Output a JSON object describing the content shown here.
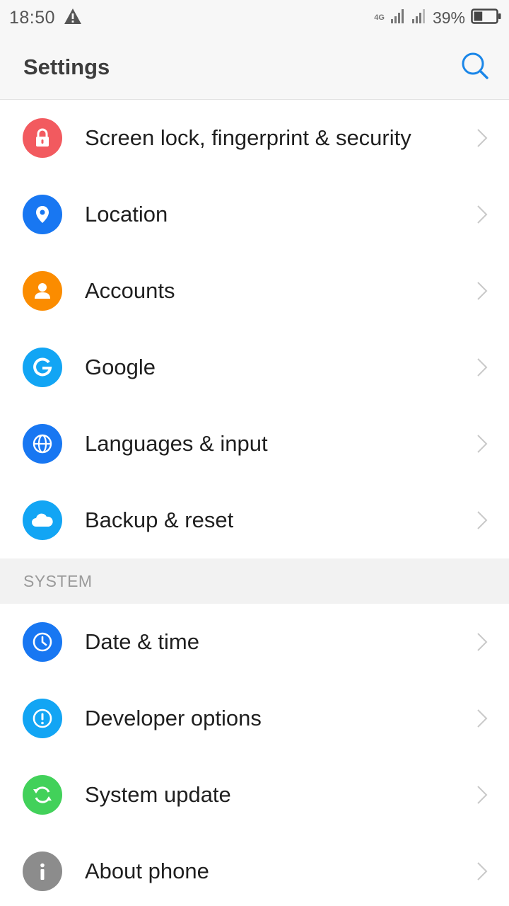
{
  "status_bar": {
    "time": "18:50",
    "network_type": "4G",
    "battery_percent": "39%",
    "battery_level": 0.39
  },
  "header": {
    "title": "Settings",
    "accent_color": "#1a86e8"
  },
  "items": [
    {
      "label": "Screen lock, fingerprint & security",
      "icon": "lock-icon",
      "color": "#f25a5f"
    },
    {
      "label": "Location",
      "icon": "location-pin-icon",
      "color": "#1877f2"
    },
    {
      "label": "Accounts",
      "icon": "person-icon",
      "color": "#fb8c00"
    },
    {
      "label": "Google",
      "icon": "google-g-icon",
      "color": "#12a5f4"
    },
    {
      "label": "Languages & input",
      "icon": "globe-icon",
      "color": "#1877f2"
    },
    {
      "label": "Backup & reset",
      "icon": "cloud-icon",
      "color": "#12a5f4"
    }
  ],
  "system_section": {
    "header": "SYSTEM",
    "items": [
      {
        "label": "Date & time",
        "icon": "clock-icon",
        "color": "#1877f2"
      },
      {
        "label": "Developer options",
        "icon": "exclamation-icon",
        "color": "#12a5f4"
      },
      {
        "label": "System update",
        "icon": "refresh-icon",
        "color": "#42d15a"
      },
      {
        "label": "About phone",
        "icon": "info-icon",
        "color": "#8c8c8c"
      }
    ]
  }
}
